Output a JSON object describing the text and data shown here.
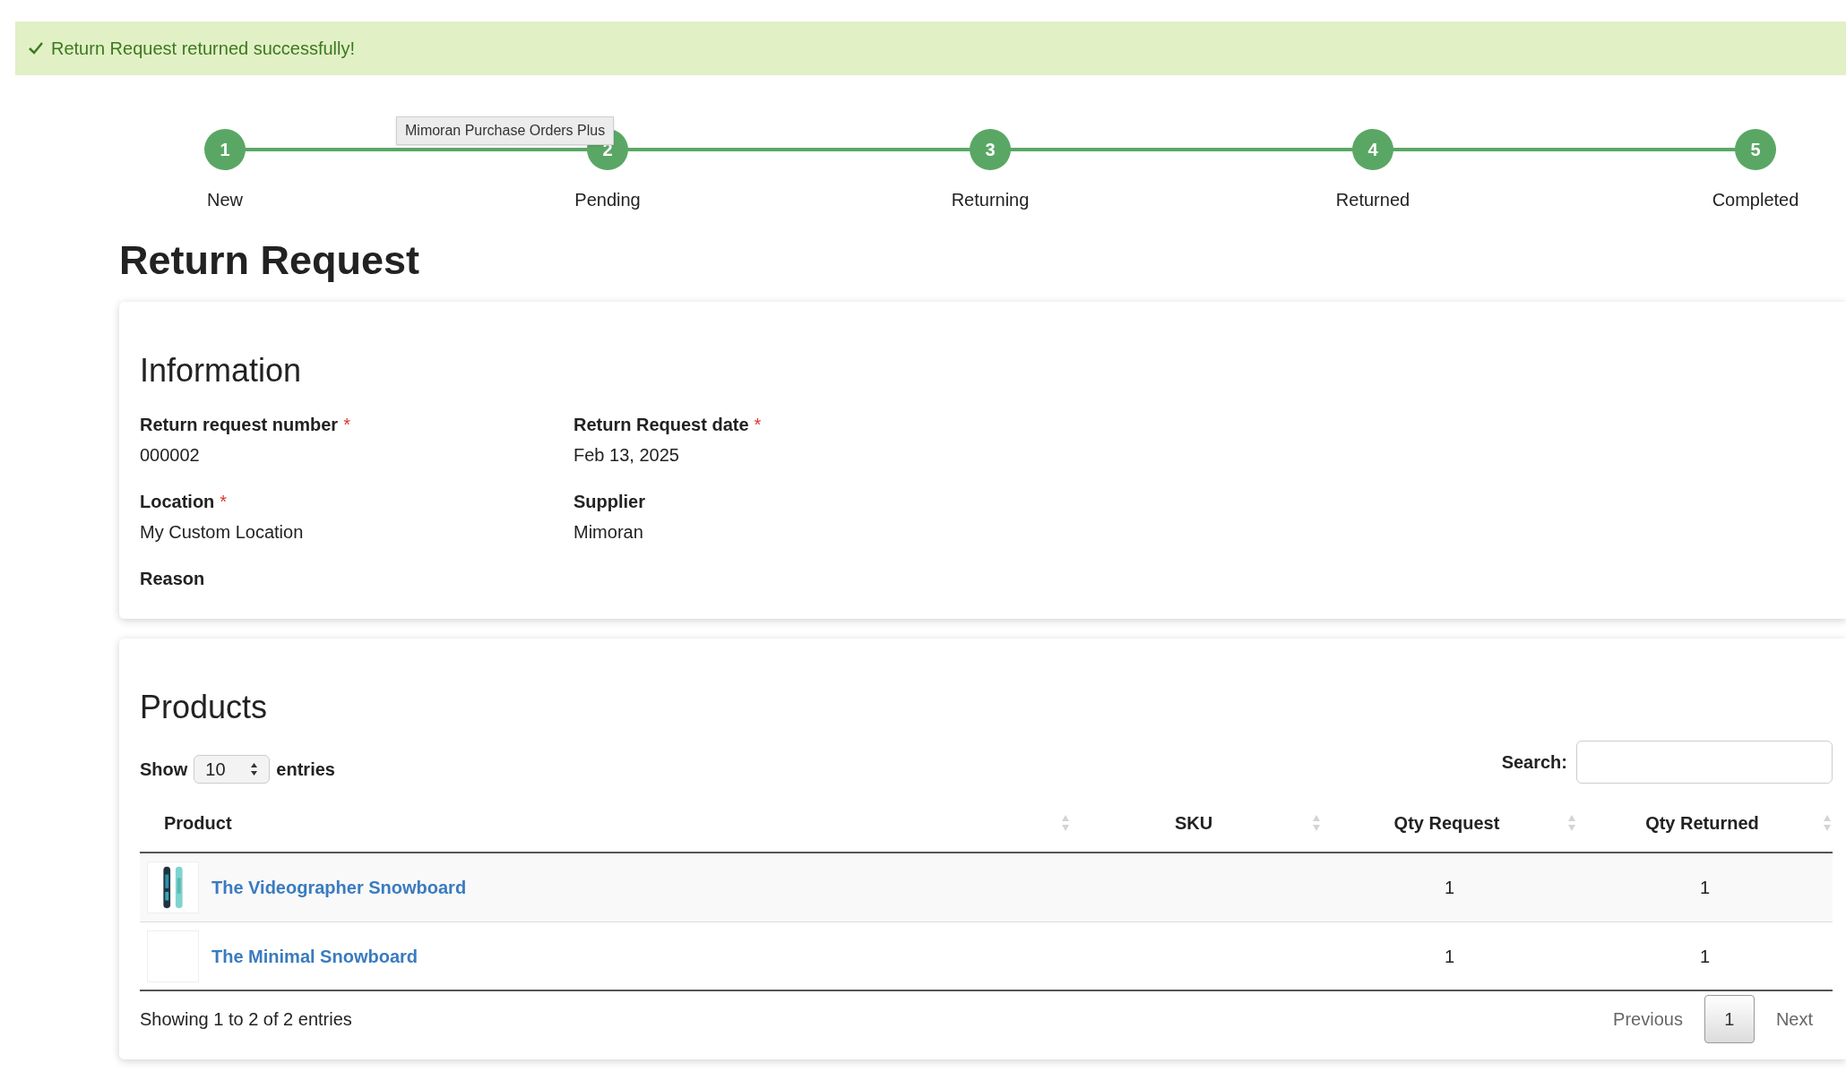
{
  "alert": {
    "text": "Return Request returned successfully!"
  },
  "steps": [
    {
      "number": "1",
      "label": "New"
    },
    {
      "number": "2",
      "label": "Pending"
    },
    {
      "number": "3",
      "label": "Returning"
    },
    {
      "number": "4",
      "label": "Returned"
    },
    {
      "number": "5",
      "label": "Completed"
    }
  ],
  "tooltip": "Mimoran Purchase Orders Plus",
  "title": "Return Request",
  "information": {
    "heading": "Information",
    "fields": [
      {
        "label": "Return request number",
        "required_mark": "*",
        "value": "000002"
      },
      {
        "label": "Return Request date",
        "required_mark": "*",
        "value": "Feb 13, 2025"
      },
      {
        "label": "Location",
        "required_mark": "*",
        "value": "My Custom Location"
      },
      {
        "label": "Supplier",
        "value": "Mimoran"
      },
      {
        "label": "Reason"
      }
    ]
  },
  "products": {
    "heading": "Products",
    "show_label": "Show",
    "page_size": "10",
    "entries_label": "entries",
    "search_label": "Search:",
    "columns": [
      "Product",
      "SKU",
      "Qty Request",
      "Qty Returned"
    ],
    "rows": [
      {
        "product": "The Videographer Snowboard",
        "qty_request": "1",
        "qty_returned": "1"
      },
      {
        "thumbnail": {
          "kind": "blank"
        },
        "product": "The Minimal Snowboard",
        "qty_request": "1",
        "qty_returned": "1"
      }
    ],
    "summary": "Showing 1 to 2 of 2 entries",
    "pagination": [
      {
        "label": "Previous",
        "kind": "nav",
        "selected": false
      },
      {
        "label": "1",
        "kind": "page",
        "selected": true
      },
      {
        "label": "Next",
        "kind": "nav",
        "selected": false
      }
    ]
  }
}
